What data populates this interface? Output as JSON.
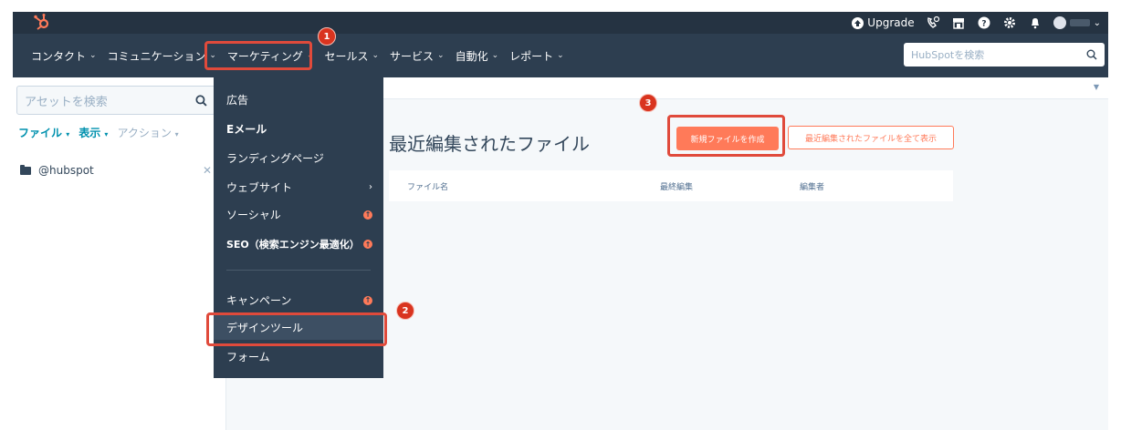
{
  "topbar": {
    "upgrade_label": "Upgrade"
  },
  "nav": {
    "items": [
      {
        "label": "コンタクト"
      },
      {
        "label": "コミュニケーション"
      },
      {
        "label": "マーケティング"
      },
      {
        "label": "セールス"
      },
      {
        "label": "サービス"
      },
      {
        "label": "自動化"
      },
      {
        "label": "レポート"
      }
    ],
    "search_placeholder": "HubSpotを検索"
  },
  "sidebar": {
    "search_placeholder": "アセットを検索",
    "actions": {
      "file": "ファイル",
      "view": "表示",
      "action": "アクション"
    },
    "folder": "@hubspot"
  },
  "dropdown": {
    "items": {
      "ads": "広告",
      "email": "Eメール",
      "landing": "ランディングページ",
      "website": "ウェブサイト",
      "social": "ソーシャル",
      "seo": "SEO（検索エンジン最適化）",
      "campaign": "キャンペーン",
      "design": "デザインツール",
      "form": "フォーム"
    }
  },
  "main": {
    "title": "最近編集されたファイル",
    "new_file_button": "新規ファイルを作成",
    "show_all_button": "最近編集されたファイルを全て表示",
    "table": {
      "col_name": "ファイル名",
      "col_edited": "最終編集",
      "col_editor": "編集者"
    }
  },
  "badges": {
    "one": "1",
    "two": "2",
    "three": "3"
  },
  "colors": {
    "topbar": "#253342",
    "nav": "#2d3e50",
    "accent": "#ff7a59",
    "highlight": "#e04a3b",
    "badge": "#d9341f"
  }
}
